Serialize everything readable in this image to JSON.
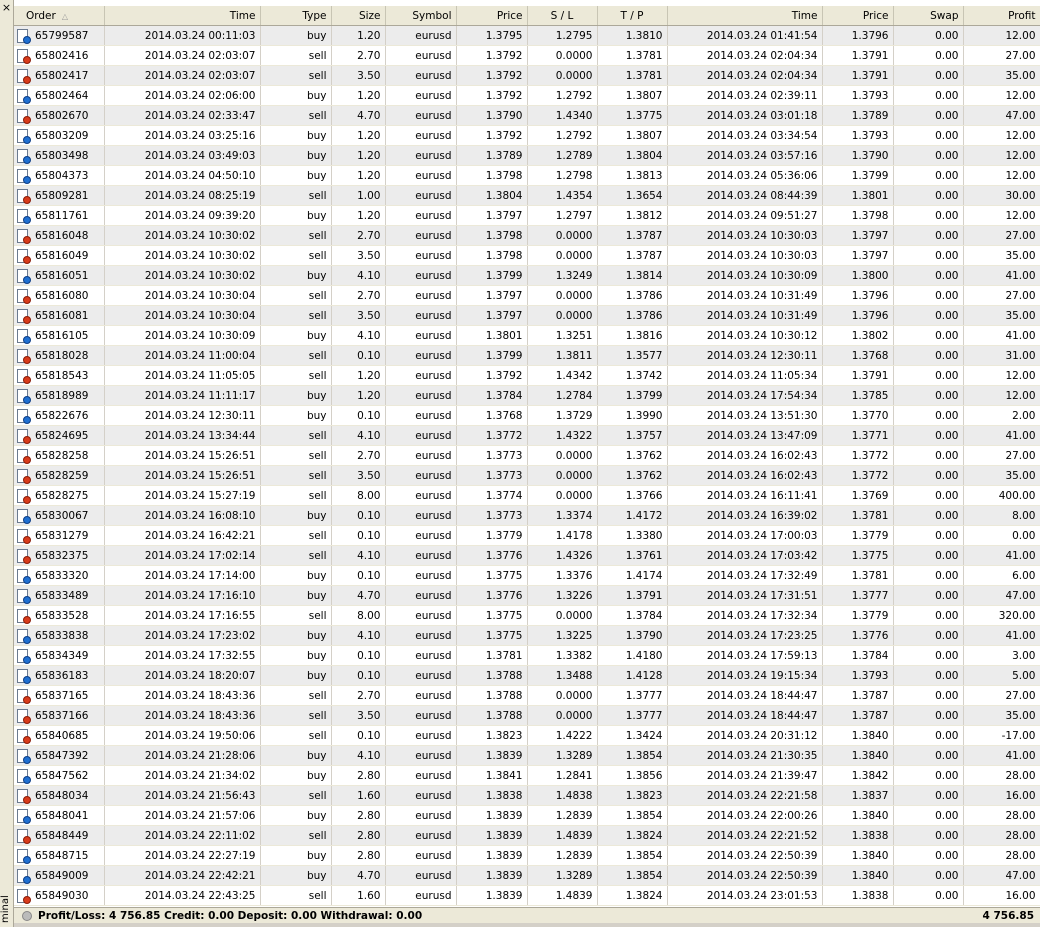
{
  "window": {
    "close_glyph": "×",
    "side_label": "minal"
  },
  "columns": [
    "Order",
    "Time",
    "Type",
    "Size",
    "Symbol",
    "Price",
    "S / L",
    "T / P",
    "Time",
    "Price",
    "Swap",
    "Profit"
  ],
  "sort_indicator": "△",
  "rows": [
    [
      "65799587",
      "2014.03.24 00:11:03",
      "buy",
      "1.20",
      "eurusd",
      "1.3795",
      "1.2795",
      "1.3810",
      "2014.03.24 01:41:54",
      "1.3796",
      "0.00",
      "12.00"
    ],
    [
      "65802416",
      "2014.03.24 02:03:07",
      "sell",
      "2.70",
      "eurusd",
      "1.3792",
      "0.0000",
      "1.3781",
      "2014.03.24 02:04:34",
      "1.3791",
      "0.00",
      "27.00"
    ],
    [
      "65802417",
      "2014.03.24 02:03:07",
      "sell",
      "3.50",
      "eurusd",
      "1.3792",
      "0.0000",
      "1.3781",
      "2014.03.24 02:04:34",
      "1.3791",
      "0.00",
      "35.00"
    ],
    [
      "65802464",
      "2014.03.24 02:06:00",
      "buy",
      "1.20",
      "eurusd",
      "1.3792",
      "1.2792",
      "1.3807",
      "2014.03.24 02:39:11",
      "1.3793",
      "0.00",
      "12.00"
    ],
    [
      "65802670",
      "2014.03.24 02:33:47",
      "sell",
      "4.70",
      "eurusd",
      "1.3790",
      "1.4340",
      "1.3775",
      "2014.03.24 03:01:18",
      "1.3789",
      "0.00",
      "47.00"
    ],
    [
      "65803209",
      "2014.03.24 03:25:16",
      "buy",
      "1.20",
      "eurusd",
      "1.3792",
      "1.2792",
      "1.3807",
      "2014.03.24 03:34:54",
      "1.3793",
      "0.00",
      "12.00"
    ],
    [
      "65803498",
      "2014.03.24 03:49:03",
      "buy",
      "1.20",
      "eurusd",
      "1.3789",
      "1.2789",
      "1.3804",
      "2014.03.24 03:57:16",
      "1.3790",
      "0.00",
      "12.00"
    ],
    [
      "65804373",
      "2014.03.24 04:50:10",
      "buy",
      "1.20",
      "eurusd",
      "1.3798",
      "1.2798",
      "1.3813",
      "2014.03.24 05:36:06",
      "1.3799",
      "0.00",
      "12.00"
    ],
    [
      "65809281",
      "2014.03.24 08:25:19",
      "sell",
      "1.00",
      "eurusd",
      "1.3804",
      "1.4354",
      "1.3654",
      "2014.03.24 08:44:39",
      "1.3801",
      "0.00",
      "30.00"
    ],
    [
      "65811761",
      "2014.03.24 09:39:20",
      "buy",
      "1.20",
      "eurusd",
      "1.3797",
      "1.2797",
      "1.3812",
      "2014.03.24 09:51:27",
      "1.3798",
      "0.00",
      "12.00"
    ],
    [
      "65816048",
      "2014.03.24 10:30:02",
      "sell",
      "2.70",
      "eurusd",
      "1.3798",
      "0.0000",
      "1.3787",
      "2014.03.24 10:30:03",
      "1.3797",
      "0.00",
      "27.00"
    ],
    [
      "65816049",
      "2014.03.24 10:30:02",
      "sell",
      "3.50",
      "eurusd",
      "1.3798",
      "0.0000",
      "1.3787",
      "2014.03.24 10:30:03",
      "1.3797",
      "0.00",
      "35.00"
    ],
    [
      "65816051",
      "2014.03.24 10:30:02",
      "buy",
      "4.10",
      "eurusd",
      "1.3799",
      "1.3249",
      "1.3814",
      "2014.03.24 10:30:09",
      "1.3800",
      "0.00",
      "41.00"
    ],
    [
      "65816080",
      "2014.03.24 10:30:04",
      "sell",
      "2.70",
      "eurusd",
      "1.3797",
      "0.0000",
      "1.3786",
      "2014.03.24 10:31:49",
      "1.3796",
      "0.00",
      "27.00"
    ],
    [
      "65816081",
      "2014.03.24 10:30:04",
      "sell",
      "3.50",
      "eurusd",
      "1.3797",
      "0.0000",
      "1.3786",
      "2014.03.24 10:31:49",
      "1.3796",
      "0.00",
      "35.00"
    ],
    [
      "65816105",
      "2014.03.24 10:30:09",
      "buy",
      "4.10",
      "eurusd",
      "1.3801",
      "1.3251",
      "1.3816",
      "2014.03.24 10:30:12",
      "1.3802",
      "0.00",
      "41.00"
    ],
    [
      "65818028",
      "2014.03.24 11:00:04",
      "sell",
      "0.10",
      "eurusd",
      "1.3799",
      "1.3811",
      "1.3577",
      "2014.03.24 12:30:11",
      "1.3768",
      "0.00",
      "31.00"
    ],
    [
      "65818543",
      "2014.03.24 11:05:05",
      "sell",
      "1.20",
      "eurusd",
      "1.3792",
      "1.4342",
      "1.3742",
      "2014.03.24 11:05:34",
      "1.3791",
      "0.00",
      "12.00"
    ],
    [
      "65818989",
      "2014.03.24 11:11:17",
      "buy",
      "1.20",
      "eurusd",
      "1.3784",
      "1.2784",
      "1.3799",
      "2014.03.24 17:54:34",
      "1.3785",
      "0.00",
      "12.00"
    ],
    [
      "65822676",
      "2014.03.24 12:30:11",
      "buy",
      "0.10",
      "eurusd",
      "1.3768",
      "1.3729",
      "1.3990",
      "2014.03.24 13:51:30",
      "1.3770",
      "0.00",
      "2.00"
    ],
    [
      "65824695",
      "2014.03.24 13:34:44",
      "sell",
      "4.10",
      "eurusd",
      "1.3772",
      "1.4322",
      "1.3757",
      "2014.03.24 13:47:09",
      "1.3771",
      "0.00",
      "41.00"
    ],
    [
      "65828258",
      "2014.03.24 15:26:51",
      "sell",
      "2.70",
      "eurusd",
      "1.3773",
      "0.0000",
      "1.3762",
      "2014.03.24 16:02:43",
      "1.3772",
      "0.00",
      "27.00"
    ],
    [
      "65828259",
      "2014.03.24 15:26:51",
      "sell",
      "3.50",
      "eurusd",
      "1.3773",
      "0.0000",
      "1.3762",
      "2014.03.24 16:02:43",
      "1.3772",
      "0.00",
      "35.00"
    ],
    [
      "65828275",
      "2014.03.24 15:27:19",
      "sell",
      "8.00",
      "eurusd",
      "1.3774",
      "0.0000",
      "1.3766",
      "2014.03.24 16:11:41",
      "1.3769",
      "0.00",
      "400.00"
    ],
    [
      "65830067",
      "2014.03.24 16:08:10",
      "buy",
      "0.10",
      "eurusd",
      "1.3773",
      "1.3374",
      "1.4172",
      "2014.03.24 16:39:02",
      "1.3781",
      "0.00",
      "8.00"
    ],
    [
      "65831279",
      "2014.03.24 16:42:21",
      "sell",
      "0.10",
      "eurusd",
      "1.3779",
      "1.4178",
      "1.3380",
      "2014.03.24 17:00:03",
      "1.3779",
      "0.00",
      "0.00"
    ],
    [
      "65832375",
      "2014.03.24 17:02:14",
      "sell",
      "4.10",
      "eurusd",
      "1.3776",
      "1.4326",
      "1.3761",
      "2014.03.24 17:03:42",
      "1.3775",
      "0.00",
      "41.00"
    ],
    [
      "65833320",
      "2014.03.24 17:14:00",
      "buy",
      "0.10",
      "eurusd",
      "1.3775",
      "1.3376",
      "1.4174",
      "2014.03.24 17:32:49",
      "1.3781",
      "0.00",
      "6.00"
    ],
    [
      "65833489",
      "2014.03.24 17:16:10",
      "buy",
      "4.70",
      "eurusd",
      "1.3776",
      "1.3226",
      "1.3791",
      "2014.03.24 17:31:51",
      "1.3777",
      "0.00",
      "47.00"
    ],
    [
      "65833528",
      "2014.03.24 17:16:55",
      "sell",
      "8.00",
      "eurusd",
      "1.3775",
      "0.0000",
      "1.3784",
      "2014.03.24 17:32:34",
      "1.3779",
      "0.00",
      "320.00"
    ],
    [
      "65833838",
      "2014.03.24 17:23:02",
      "buy",
      "4.10",
      "eurusd",
      "1.3775",
      "1.3225",
      "1.3790",
      "2014.03.24 17:23:25",
      "1.3776",
      "0.00",
      "41.00"
    ],
    [
      "65834349",
      "2014.03.24 17:32:55",
      "buy",
      "0.10",
      "eurusd",
      "1.3781",
      "1.3382",
      "1.4180",
      "2014.03.24 17:59:13",
      "1.3784",
      "0.00",
      "3.00"
    ],
    [
      "65836183",
      "2014.03.24 18:20:07",
      "buy",
      "0.10",
      "eurusd",
      "1.3788",
      "1.3488",
      "1.4128",
      "2014.03.24 19:15:34",
      "1.3793",
      "0.00",
      "5.00"
    ],
    [
      "65837165",
      "2014.03.24 18:43:36",
      "sell",
      "2.70",
      "eurusd",
      "1.3788",
      "0.0000",
      "1.3777",
      "2014.03.24 18:44:47",
      "1.3787",
      "0.00",
      "27.00"
    ],
    [
      "65837166",
      "2014.03.24 18:43:36",
      "sell",
      "3.50",
      "eurusd",
      "1.3788",
      "0.0000",
      "1.3777",
      "2014.03.24 18:44:47",
      "1.3787",
      "0.00",
      "35.00"
    ],
    [
      "65840685",
      "2014.03.24 19:50:06",
      "sell",
      "0.10",
      "eurusd",
      "1.3823",
      "1.4222",
      "1.3424",
      "2014.03.24 20:31:12",
      "1.3840",
      "0.00",
      "-17.00"
    ],
    [
      "65847392",
      "2014.03.24 21:28:06",
      "buy",
      "4.10",
      "eurusd",
      "1.3839",
      "1.3289",
      "1.3854",
      "2014.03.24 21:30:35",
      "1.3840",
      "0.00",
      "41.00"
    ],
    [
      "65847562",
      "2014.03.24 21:34:02",
      "buy",
      "2.80",
      "eurusd",
      "1.3841",
      "1.2841",
      "1.3856",
      "2014.03.24 21:39:47",
      "1.3842",
      "0.00",
      "28.00"
    ],
    [
      "65848034",
      "2014.03.24 21:56:43",
      "sell",
      "1.60",
      "eurusd",
      "1.3838",
      "1.4838",
      "1.3823",
      "2014.03.24 22:21:58",
      "1.3837",
      "0.00",
      "16.00"
    ],
    [
      "65848041",
      "2014.03.24 21:57:06",
      "buy",
      "2.80",
      "eurusd",
      "1.3839",
      "1.2839",
      "1.3854",
      "2014.03.24 22:00:26",
      "1.3840",
      "0.00",
      "28.00"
    ],
    [
      "65848449",
      "2014.03.24 22:11:02",
      "sell",
      "2.80",
      "eurusd",
      "1.3839",
      "1.4839",
      "1.3824",
      "2014.03.24 22:21:52",
      "1.3838",
      "0.00",
      "28.00"
    ],
    [
      "65848715",
      "2014.03.24 22:27:19",
      "buy",
      "2.80",
      "eurusd",
      "1.3839",
      "1.2839",
      "1.3854",
      "2014.03.24 22:50:39",
      "1.3840",
      "0.00",
      "28.00"
    ],
    [
      "65849009",
      "2014.03.24 22:42:21",
      "buy",
      "4.70",
      "eurusd",
      "1.3839",
      "1.3289",
      "1.3854",
      "2014.03.24 22:50:39",
      "1.3840",
      "0.00",
      "47.00"
    ],
    [
      "65849030",
      "2014.03.24 22:43:25",
      "sell",
      "1.60",
      "eurusd",
      "1.3839",
      "1.4839",
      "1.3824",
      "2014.03.24 23:01:53",
      "1.3838",
      "0.00",
      "16.00"
    ]
  ],
  "summary": {
    "text": "Profit/Loss: 4 756.85  Credit: 0.00  Deposit: 0.00  Withdrawal: 0.00",
    "total": "4 756.85"
  },
  "colors": {
    "buy_icon": "#1f6fd1",
    "sell_icon": "#d83b1b",
    "alt_row": "#ececec",
    "chrome": "#ece9d8"
  },
  "icons": {
    "buy": "document-buy-icon",
    "sell": "document-sell-icon"
  }
}
